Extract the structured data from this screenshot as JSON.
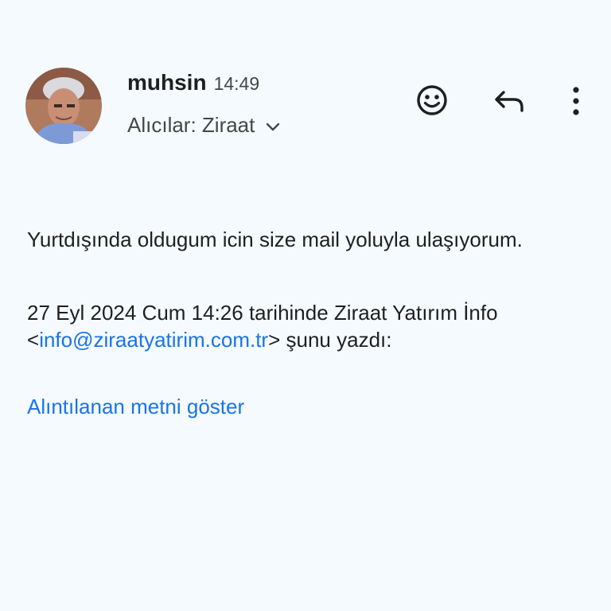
{
  "header": {
    "sender_name": "muhsin",
    "time": "14:49",
    "recipients": "Alıcılar: Ziraat",
    "avatar": "avatar-photo",
    "actions": {
      "emoji_icon": "add-emoji-icon",
      "reply_icon": "reply-icon",
      "more_icon": "more-vert-icon"
    }
  },
  "message": {
    "body_line": "Yurtdışında oldugum icin size mail yoluyla ulaşıyorum.",
    "quote_header_line1": "27 Eyl 2024 Cum 14:26 tarihinde Ziraat Yatırım İnfo",
    "quote_lt": "<",
    "quote_email": "info@ziraatyatirim.com.tr",
    "quote_suffix": "> şunu yazdı:",
    "show_quoted_label": "Alıntılanan metni göster"
  },
  "colors": {
    "background": "#f4fafd",
    "text": "#1f1f1f",
    "secondary_text": "#444746",
    "link": "#1a73e8"
  }
}
